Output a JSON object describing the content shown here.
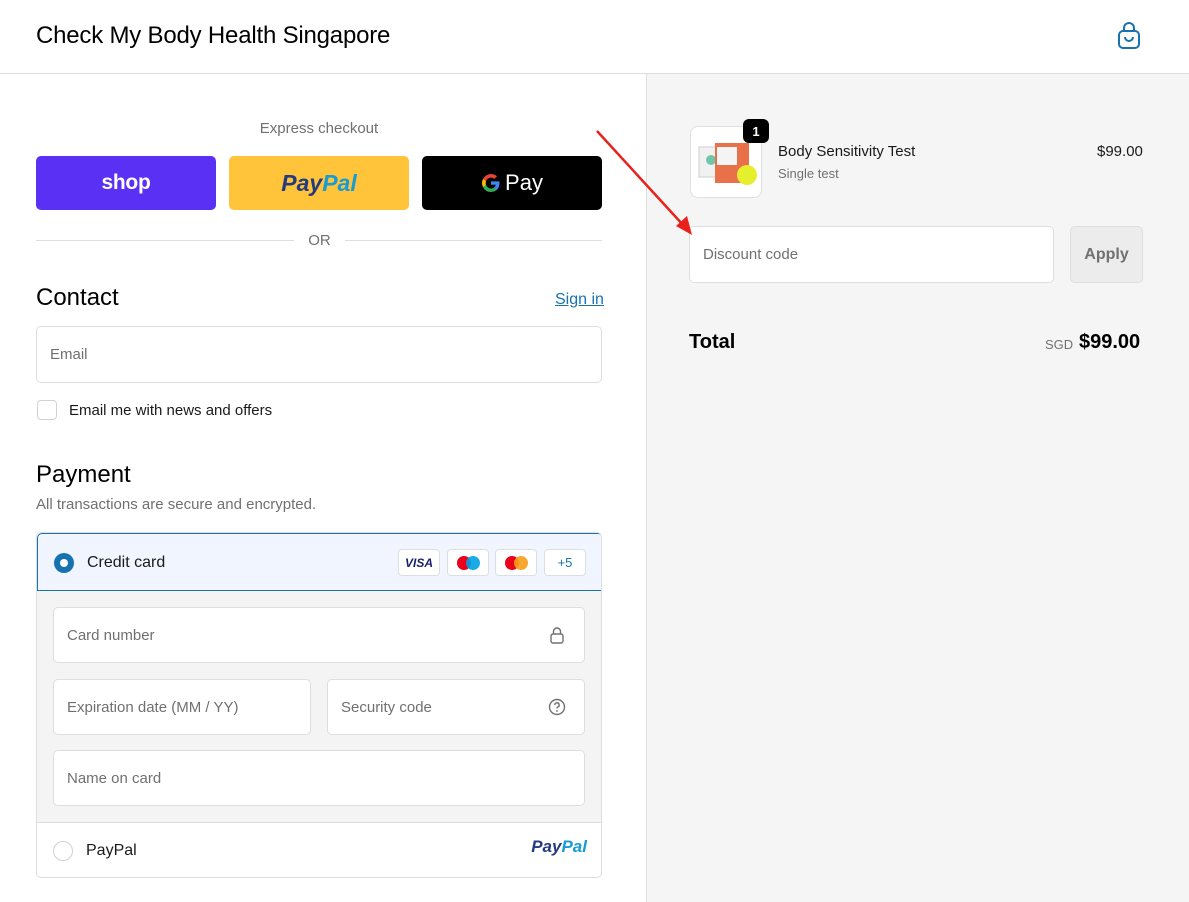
{
  "header": {
    "store_name": "Check My Body Health Singapore",
    "cart_icon": "shopping-bag-icon"
  },
  "express": {
    "label": "Express checkout",
    "shop_label": "shop",
    "paypal_label_1": "Pay",
    "paypal_label_2": "Pal",
    "gpay_g": "G",
    "gpay_label": "Pay",
    "or": "OR"
  },
  "contact": {
    "heading": "Contact",
    "sign_in": "Sign in",
    "email_placeholder": "Email",
    "newsletter_label": "Email me with news and offers"
  },
  "payment": {
    "heading": "Payment",
    "subtitle": "All transactions are secure and encrypted.",
    "credit_card_label": "Credit card",
    "badges": {
      "visa": "VISA",
      "more": "+5"
    },
    "card_number_placeholder": "Card number",
    "expiry_placeholder": "Expiration date (MM / YY)",
    "security_placeholder": "Security code",
    "name_placeholder": "Name on card",
    "paypal_label": "PayPal",
    "paypal_logo_1": "Pay",
    "paypal_logo_2": "Pal"
  },
  "order": {
    "quantity": "1",
    "product_name": "Body Sensitivity Test",
    "variant": "Single test",
    "price": "$99.00",
    "discount_placeholder": "Discount code",
    "apply_label": "Apply",
    "total_label": "Total",
    "currency": "SGD",
    "total_value": "$99.00"
  },
  "colors": {
    "accent": "#1773b0",
    "shop_purple": "#5a31f4",
    "paypal_yellow": "#ffc439",
    "annotation_arrow": "#e8221b"
  }
}
